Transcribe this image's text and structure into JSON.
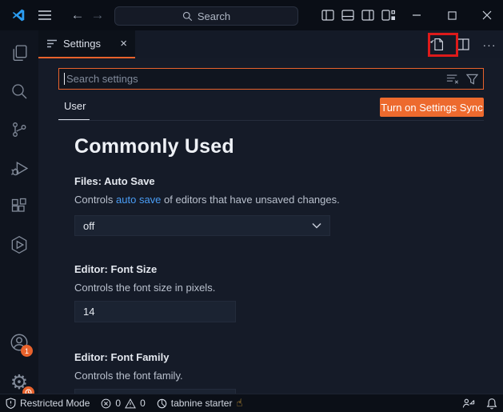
{
  "titlebar": {
    "search_placeholder": "Search",
    "minimize": "–",
    "maximize": "□",
    "close": "✕",
    "back": "←",
    "forward": "→"
  },
  "tabbar": {
    "tab_label": "Settings",
    "tab_close": "×",
    "more_actions": "···"
  },
  "settings": {
    "search_placeholder": "Search settings",
    "scope_tab": "User",
    "sync_button": "Turn on Settings Sync",
    "section_title": "Commonly Used",
    "items": {
      "0": {
        "title": "Files: Auto Save",
        "desc_prefix": "Controls ",
        "link": "auto save",
        "desc_suffix": " of editors that have unsaved changes.",
        "value": "off"
      },
      "1": {
        "title": "Editor: Font Size",
        "desc": "Controls the font size in pixels.",
        "value": "14"
      },
      "2": {
        "title": "Editor: Font Family",
        "desc": "Controls the font family.",
        "value": ""
      }
    }
  },
  "activitybar": {
    "accounts_badge": "1"
  },
  "statusbar": {
    "restricted_mode": "Restricted Mode",
    "errors": "0",
    "warnings": "0",
    "extension": "tabnine starter",
    "hand": "☝"
  },
  "colors": {
    "accent_orange": "#e8622c",
    "sync_button_bg": "#ed6a2e",
    "link_blue": "#4a9df5",
    "highlight_red": "#dd1a1a",
    "badge_orange": "#e8622c"
  }
}
